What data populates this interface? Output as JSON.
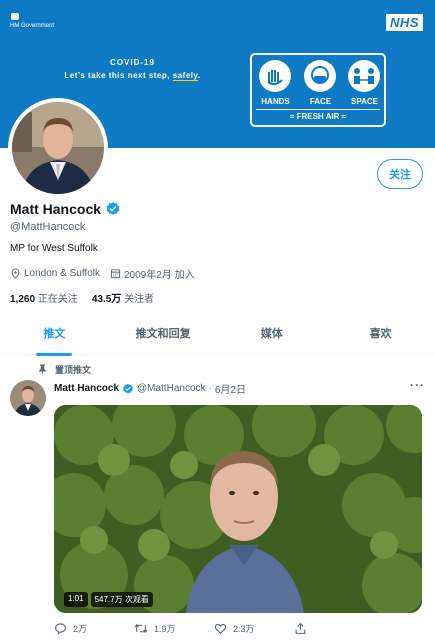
{
  "banner": {
    "gov_label": "HM Government",
    "nhs_label": "NHS",
    "covid_title": "COVID-19",
    "tagline_prefix": "Let’s take this next step, ",
    "tagline_emphasis": "safely",
    "tagline_suffix": ".",
    "hands": "HANDS",
    "face": "FACE",
    "space": "SPACE",
    "fresh_air": "FRESH AIR"
  },
  "profile": {
    "name": "Matt Hancock",
    "handle": "@MattHancock",
    "bio": "MP for West Suffolk",
    "location": "London & Suffolk",
    "joined": "2009年2月 加入",
    "following_count": "1,260",
    "following_label": "正在关注",
    "followers_count": "43.5万",
    "followers_label": "关注者",
    "follow_button": "关注",
    "verified_color": "#1d9bf0"
  },
  "tabs": [
    {
      "label": "推文",
      "active": true
    },
    {
      "label": "推文和回复",
      "active": false
    },
    {
      "label": "媒体",
      "active": false
    },
    {
      "label": "喜欢",
      "active": false
    }
  ],
  "tweet": {
    "pinned_label": "置顶推文",
    "name": "Matt Hancock",
    "handle": "@MattHancock",
    "separator": "·",
    "date": "6月2日",
    "more": "···",
    "video_duration": "1:01",
    "video_views": "547.7万 次观看",
    "replies": "2万",
    "retweets": "1.9万",
    "likes": "2.3万"
  },
  "colors": {
    "accent": "#1d9bf0",
    "banner": "#0f7ac4"
  },
  "icons": [
    "gov-crest-icon",
    "location-icon",
    "calendar-icon",
    "verified-icon",
    "pin-icon",
    "reply-icon",
    "retweet-icon",
    "like-icon",
    "share-icon"
  ]
}
